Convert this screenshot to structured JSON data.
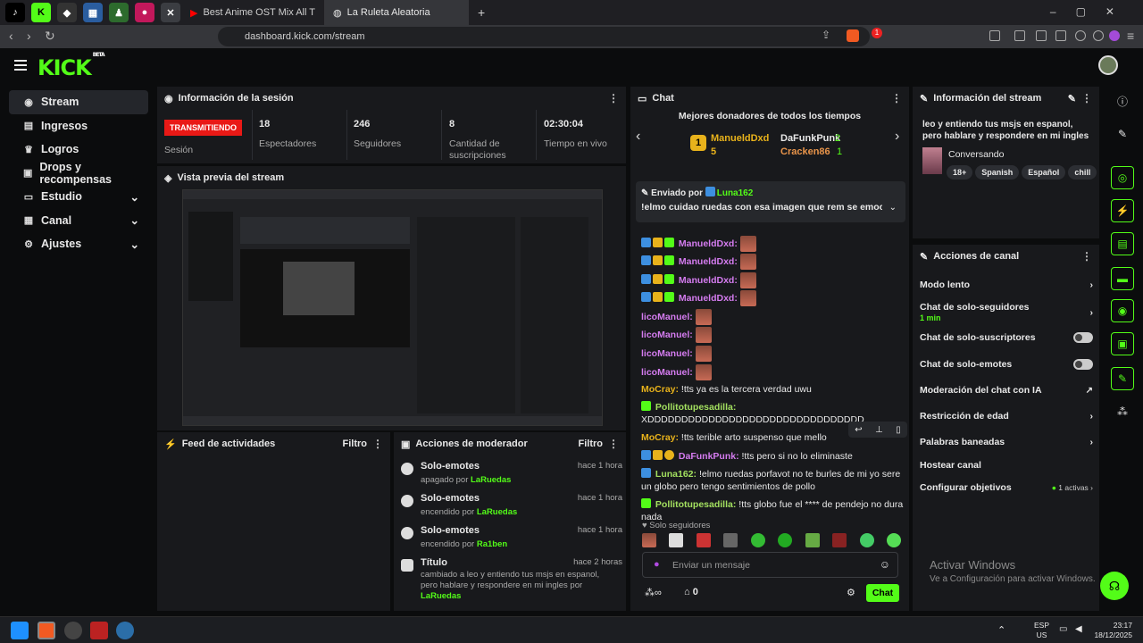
{
  "browser": {
    "tabs": [
      {
        "title": "Best Anime OST Mix All Time | Ar"
      },
      {
        "title": "La Ruleta Aleatoria"
      }
    ],
    "url": "dashboard.kick.com/stream",
    "ext_badge": "1"
  },
  "kick": {
    "logo": "KICK",
    "logo_sup": "BETA"
  },
  "sidebar": {
    "items": [
      {
        "label": "Stream",
        "icon": "broadcast-icon"
      },
      {
        "label": "Ingresos",
        "icon": "money-icon"
      },
      {
        "label": "Logros",
        "icon": "trophy-icon"
      },
      {
        "label": "Drops y recompensas",
        "icon": "gift-icon"
      },
      {
        "label": "Estudio",
        "icon": "monitor-icon"
      },
      {
        "label": "Canal",
        "icon": "grid-icon"
      },
      {
        "label": "Ajustes",
        "icon": "gear-icon"
      }
    ]
  },
  "session": {
    "title": "Información de la sesión",
    "live_label": "TRANSMITIENDO",
    "session_label": "Sesión",
    "stats": [
      {
        "value": "18",
        "label": "Espectadores"
      },
      {
        "value": "246",
        "label": "Seguidores"
      },
      {
        "value": "8",
        "label": "Cantidad de suscripciones"
      },
      {
        "value": "02:30:04",
        "label": "Tiempo en vivo"
      }
    ]
  },
  "preview": {
    "title": "Vista previa del stream"
  },
  "feed": {
    "title": "Feed de actividades",
    "filter": "Filtro"
  },
  "mod": {
    "title": "Acciones de moderador",
    "filter": "Filtro",
    "items": [
      {
        "title": "Solo-emotes",
        "sub": "apagado por ",
        "user": "LaRuedas",
        "time": "hace 1 hora"
      },
      {
        "title": "Solo-emotes",
        "sub": "encendido por ",
        "user": "LaRuedas",
        "time": "hace 1 hora"
      },
      {
        "title": "Solo-emotes",
        "sub": "encendido por ",
        "user": "Ra1ben",
        "time": "hace 1 hora"
      },
      {
        "title": "Título",
        "sub": "cambiado a leo y entiendo tus msjs en espanol, pero hablare y respondere en mi ingles por ",
        "user": "LaRuedas",
        "time": "hace 2 horas"
      }
    ]
  },
  "chat": {
    "title": "Chat",
    "donors_title": "Mejores donadores de todos los tiempos",
    "donors": [
      {
        "rank": "1",
        "name": "ManueldDxd",
        "count": "5"
      },
      {
        "name": "DaFunkPunk",
        "count": "2"
      },
      {
        "name": "Cracken86",
        "count": "1"
      }
    ],
    "pinned_by": "Enviado por ",
    "pinned_user": "Luna162",
    "pinned_msg": "!elmo cuidao ruedas con esa imagen que rem se emocina",
    "messages": [
      {
        "user": "ManueldDxd:"
      },
      {
        "user": "ManueldDxd:"
      },
      {
        "user": "ManueldDxd:"
      },
      {
        "user": "ManueldDxd:"
      },
      {
        "user": "licoManuel:"
      },
      {
        "user": "licoManuel:"
      },
      {
        "user": "licoManuel:"
      },
      {
        "user": "licoManuel:"
      }
    ],
    "m_mocray1_user": "MoCray:",
    "m_mocray1_text": " !tts ya es la tercera verdad uwu",
    "m_pollito1_user": "Pollitotupesadilla:",
    "m_pollito1_text": "XDDDDDDDDDDDDDDDDDDDDDDDDDDDDDDDD",
    "m_mocray2_user": "MoCray:",
    "m_mocray2_text": " !tts terible arto suspenso que mello",
    "m_dafunk_user": "DaFunkPunk:",
    "m_dafunk_text": " !tts pero si no lo eliminaste",
    "m_luna_user": "Luna162:",
    "m_luna_text": " !elmo ruedas porfavot no te burles de mi yo sere un globo pero tengo sentimientos de pollo",
    "m_pollito2_user": "Pollitotupesadilla:",
    "m_pollito2_text": " !tts globo fue el **** de pendejo no dura nada",
    "followers_only": "Solo seguidores",
    "input_placeholder": "Enviar un mensaje",
    "points": "0",
    "send_label": "Chat"
  },
  "stream_info": {
    "title": "Información del stream",
    "stream_title": "leo y entiendo tus msjs en espanol, pero hablare y respondere en mi ingles",
    "category": "Conversando",
    "tags": [
      "18+",
      "Spanish",
      "Español",
      "chill"
    ]
  },
  "channel_actions": {
    "title": "Acciones de canal",
    "slow": "Modo lento",
    "followers": "Chat de solo-seguidores",
    "followers_sub": "1 min",
    "subs": "Chat de solo-suscriptores",
    "emotes": "Chat de solo-emotes",
    "ai": "Moderación del chat con IA",
    "age": "Restricción de edad",
    "banned": "Palabras baneadas",
    "host": "Hostear canal",
    "goals": "Configurar objetivos",
    "goals_active": "1 activas"
  },
  "windows": {
    "activate_title": "Activar Windows",
    "activate_sub": "Ve a Configuración para activar Windows.",
    "lang": "ESP",
    "region": "US",
    "time": "23:17",
    "date": "18/12/2025"
  },
  "colors": {
    "accent": "#53fc18",
    "live": "#e91916",
    "panel": "#18191c"
  }
}
